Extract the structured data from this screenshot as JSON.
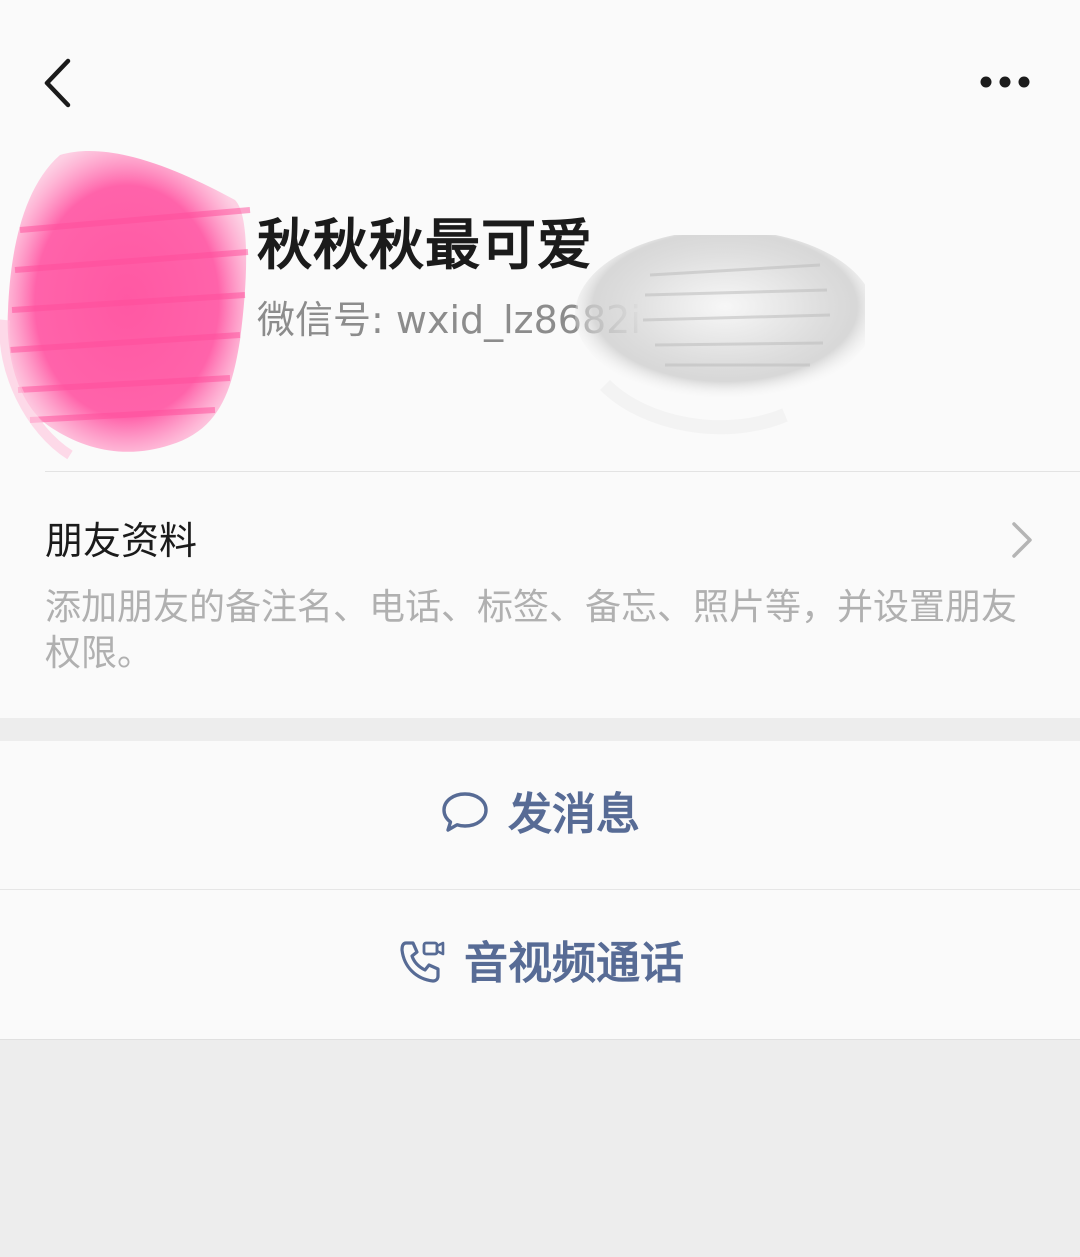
{
  "header": {
    "back_icon": "chevron-left-icon",
    "more_icon": "more-dots-icon"
  },
  "profile": {
    "name": "秋秋秋最可爱",
    "wechat_id": "微信号: wxid_lz8682i"
  },
  "friend_info": {
    "title": "朋友资料",
    "description": "添加朋友的备注名、电话、标签、备忘、照片等，并设置朋友权限。",
    "chevron_icon": "chevron-right-icon"
  },
  "actions": {
    "message_label": "发消息",
    "message_icon": "chat-bubble-icon",
    "call_label": "音视频通话",
    "call_icon": "video-call-icon"
  },
  "colors": {
    "link_blue": "#576b95",
    "avatar_pink": "#ff5aa3",
    "background": "#ededed",
    "panel": "#fafafa"
  }
}
